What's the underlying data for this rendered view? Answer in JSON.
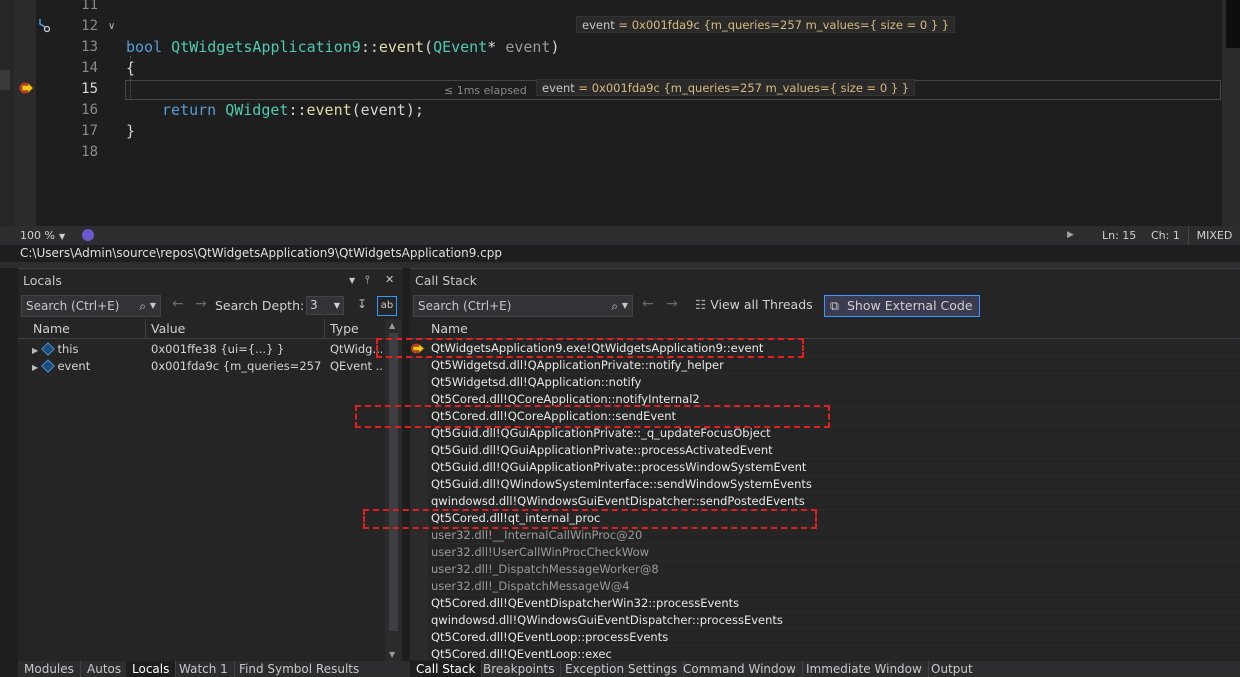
{
  "editor": {
    "lines": [
      {
        "num": "11",
        "code": ""
      },
      {
        "num": "12",
        "code": "bool QtWidgetsApplication9::event(QEvent* event)"
      },
      {
        "num": "13",
        "code": "{"
      },
      {
        "num": "14",
        "code": ""
      },
      {
        "num": "15",
        "code": "return QWidget::event(event);"
      },
      {
        "num": "16",
        "code": "}"
      },
      {
        "num": "17",
        "code": ""
      },
      {
        "num": "18",
        "code": ""
      }
    ],
    "sig": {
      "kw_bool": "bool",
      "cls": "QtWidgetsApplication9",
      "sep": "::",
      "fn": "event",
      "open": "(",
      "ptype": "QEvent",
      "star": "* ",
      "pname": "event",
      "close": ")"
    },
    "ret": {
      "kw_return": "return",
      "cls": "QWidget",
      "sep": "::",
      "fn": "event",
      "args": "(event);"
    },
    "brace_open": "{",
    "brace_close": "}",
    "datatip_line12": {
      "name": "event",
      "value": " = 0x001fda9c {m_queries=257 m_values={ size = 0 } }"
    },
    "datatip_line15": {
      "name": "event",
      "value": " = 0x001fda9c {m_queries=257 m_values={ size = 0 } }"
    },
    "perf_tip": "≤ 1ms elapsed",
    "current_line": 15
  },
  "status": {
    "zoom": "100 %",
    "line": "Ln: 15",
    "col": "Ch: 1",
    "mode": "MIXED"
  },
  "filepath": "C:\\Users\\Admin\\source\\repos\\QtWidgetsApplication9\\QtWidgetsApplication9.cpp",
  "locals": {
    "title": "Locals",
    "search_placeholder": "Search (Ctrl+E)",
    "depth_label": "Search Depth:",
    "depth_value": "3",
    "columns": [
      "Name",
      "Value",
      "Type"
    ],
    "rows": [
      {
        "name": "this",
        "value": "0x001ffe38 {ui={...} }",
        "type": "QtWidg..."
      },
      {
        "name": "event",
        "value": "0x001fda9c {m_queries=257 m_...",
        "type": "QEvent ..."
      }
    ]
  },
  "callstack": {
    "title": "Call Stack",
    "search_placeholder": "Search (Ctrl+E)",
    "view_all_threads": "View all Threads",
    "show_external_code": "Show External Code",
    "column": "Name",
    "frames": [
      "QtWidgetsApplication9.exe!QtWidgetsApplication9::event",
      "Qt5Widgetsd.dll!QApplicationPrivate::notify_helper",
      "Qt5Widgetsd.dll!QApplication::notify",
      "Qt5Cored.dll!QCoreApplication::notifyInternal2",
      "Qt5Cored.dll!QCoreApplication::sendEvent",
      "Qt5Guid.dll!QGuiApplicationPrivate::_q_updateFocusObject",
      "Qt5Guid.dll!QGuiApplicationPrivate::processActivatedEvent",
      "Qt5Guid.dll!QGuiApplicationPrivate::processWindowSystemEvent",
      "Qt5Guid.dll!QWindowSystemInterface::sendWindowSystemEvents",
      "qwindowsd.dll!QWindowsGuiEventDispatcher::sendPostedEvents",
      "Qt5Cored.dll!qt_internal_proc",
      "user32.dll!__InternalCallWinProc@20",
      "user32.dll!UserCallWinProcCheckWow",
      "user32.dll!_DispatchMessageWorker@8",
      "user32.dll!_DispatchMessageW@4",
      "Qt5Cored.dll!QEventDispatcherWin32::processEvents",
      "qwindowsd.dll!QWindowsGuiEventDispatcher::processEvents",
      "Qt5Cored.dll!QEventLoop::processEvents",
      "Qt5Cored.dll!QEventLoop::exec"
    ]
  },
  "bottom_tabs_left": [
    "Modules",
    "Autos",
    "Locals",
    "Watch 1",
    "Find Symbol Results"
  ],
  "bottom_tabs_right": [
    "Call Stack",
    "Breakpoints",
    "Exception Settings",
    "Command Window",
    "Immediate Window",
    "Output"
  ],
  "colors": {
    "highlight_box": "#e02020",
    "accent": "#3399ff",
    "keyword": "#569cd6",
    "type": "#4ec9b0",
    "function": "#dcdcaa"
  }
}
